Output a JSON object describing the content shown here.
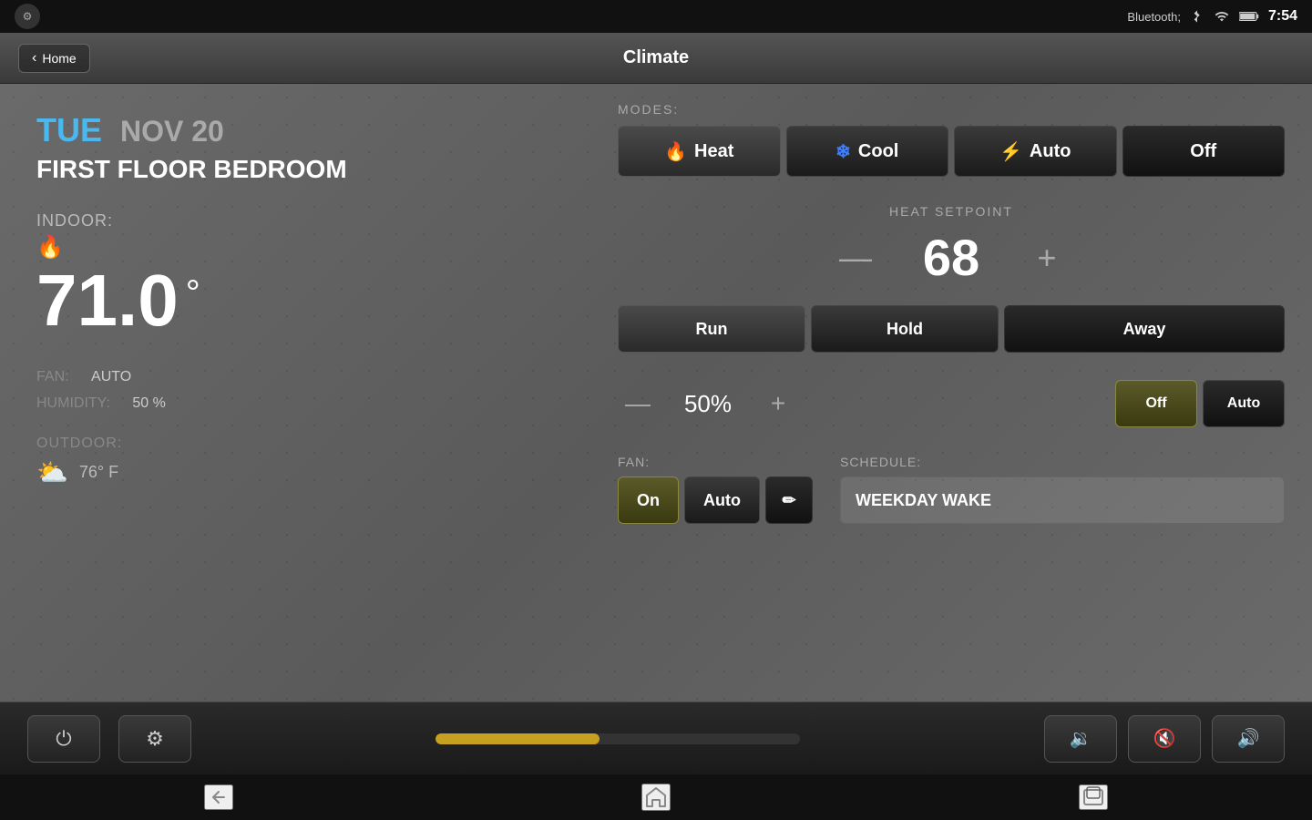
{
  "statusBar": {
    "time": "7:54"
  },
  "navBar": {
    "homeLabel": "Home",
    "title": "Climate"
  },
  "leftPanel": {
    "day": "TUE",
    "date": "NOV 20",
    "location": "FIRST FLOOR BEDROOM",
    "indoorLabel": "INDOOR:",
    "indoorTemp": "71.0",
    "degree": "°",
    "fanLabel": "FAN:",
    "fanValue": "AUTO",
    "humidityLabel": "HUMIDITY:",
    "humidityValue": "50 %",
    "outdoorLabel": "OUTDOOR:",
    "outdoorTemp": "76° F"
  },
  "rightPanel": {
    "modesLabel": "MODES:",
    "modeButtons": [
      "Heat",
      "Cool",
      "Auto",
      "Off"
    ],
    "heatSetpointLabel": "HEAT SETPOINT",
    "heatSetpointValue": "68",
    "decreaseLabel": "—",
    "increaseLabel": "+",
    "scheduleButtons": [
      "Run",
      "Hold",
      "Away"
    ],
    "humidityValue": "50%",
    "humidityDecreaseLabel": "—",
    "humidityIncreaseLabel": "+",
    "humidityOffLabel": "Off",
    "humidityAutoLabel": "Auto",
    "fanLabel": "FAN:",
    "fanOnLabel": "On",
    "fanAutoLabel": "Auto",
    "scheduleLabel": "SCHEDULE:",
    "scheduleValue": "WEEKDAY WAKE"
  },
  "toolbar": {
    "progressPercent": 45,
    "powerIcon": "⏻",
    "gearIcon": "⚙",
    "volDownIcon": "🔉",
    "muteIcon": "🔇",
    "volUpIcon": "🔊"
  },
  "androidNav": {
    "backIcon": "←",
    "homeIcon": "⌂",
    "recentIcon": "▭"
  }
}
